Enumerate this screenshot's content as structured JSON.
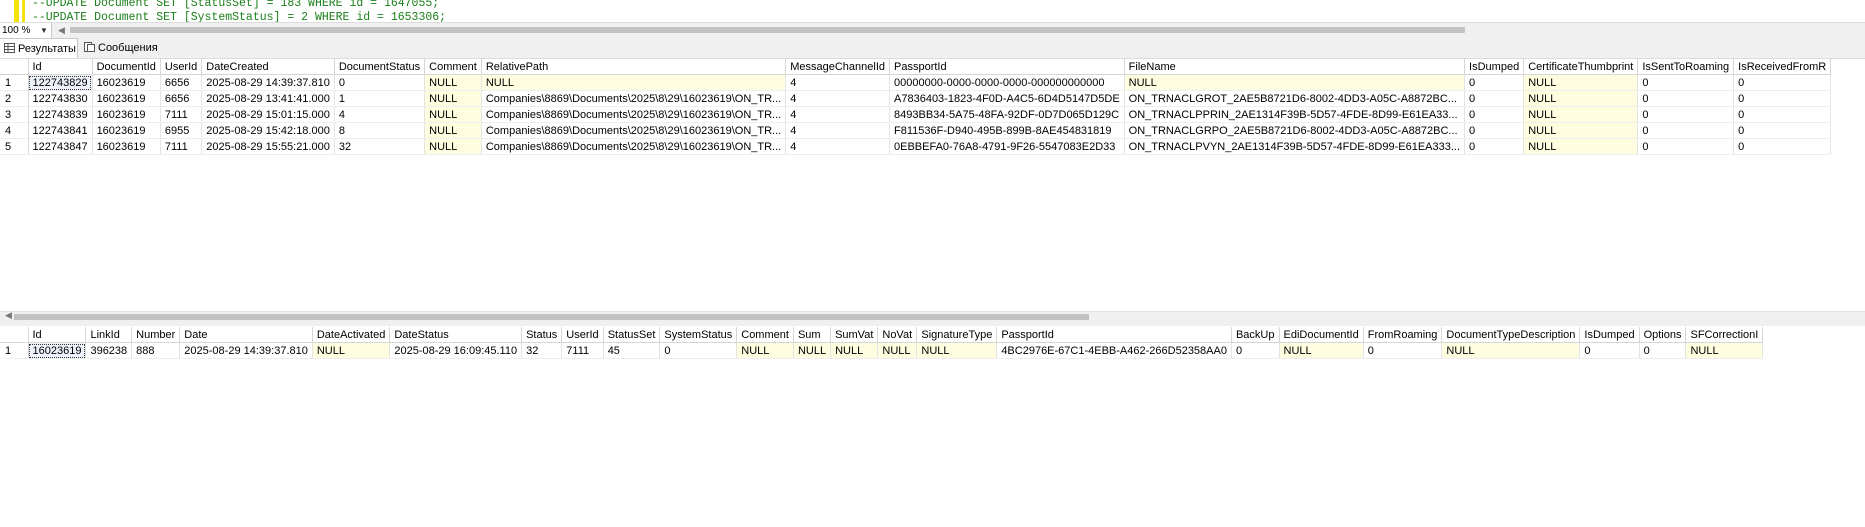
{
  "editor": {
    "line1": "--UPDATE Document SET [StatusSet] = 183 WHERE id = 1647055;",
    "line2": "--UPDATE Document SET [SystemStatus] = 2 WHERE id = 1653306;"
  },
  "zoom": {
    "value": "100 %"
  },
  "tabs": {
    "results": "Результаты",
    "messages": "Сообщения"
  },
  "grid1": {
    "columns": [
      "Id",
      "DocumentId",
      "UserId",
      "DateCreated",
      "DocumentStatus",
      "Comment",
      "RelativePath",
      "MessageChannelId",
      "PassportId",
      "FileName",
      "IsDumped",
      "CertificateThumbprint",
      "IsSentToRoaming",
      "IsReceivedFromR"
    ],
    "rows": [
      {
        "n": "1",
        "c": [
          "122743829",
          "16023619",
          "6656",
          "2025-08-29 14:39:37.810",
          "0",
          "NULL",
          "NULL",
          "4",
          "00000000-0000-0000-0000-000000000000",
          "NULL",
          "0",
          "NULL",
          "0",
          "0"
        ]
      },
      {
        "n": "2",
        "c": [
          "122743830",
          "16023619",
          "6656",
          "2025-08-29 13:41:41.000",
          "1",
          "NULL",
          "Companies\\8869\\Documents\\2025\\8\\29\\16023619\\ON_TR...",
          "4",
          "A7836403-1823-4F0D-A4C5-6D4D5147D5DE",
          "ON_TRNACLGROT_2AE5B8721D6-8002-4DD3-A05C-A8872BC...",
          "0",
          "NULL",
          "0",
          "0"
        ]
      },
      {
        "n": "3",
        "c": [
          "122743839",
          "16023619",
          "7111",
          "2025-08-29 15:01:15.000",
          "4",
          "NULL",
          "Companies\\8869\\Documents\\2025\\8\\29\\16023619\\ON_TR...",
          "4",
          "8493BB34-5A75-48FA-92DF-0D7D065D129C",
          "ON_TRNACLPPRIN_2AE1314F39B-5D57-4FDE-8D99-E61EA33...",
          "0",
          "NULL",
          "0",
          "0"
        ]
      },
      {
        "n": "4",
        "c": [
          "122743841",
          "16023619",
          "6955",
          "2025-08-29 15:42:18.000",
          "8",
          "NULL",
          "Companies\\8869\\Documents\\2025\\8\\29\\16023619\\ON_TR...",
          "4",
          "F811536F-D940-495B-899B-8AE454831819",
          "ON_TRNACLGRPO_2AE5B8721D6-8002-4DD3-A05C-A8872BC...",
          "0",
          "NULL",
          "0",
          "0"
        ]
      },
      {
        "n": "5",
        "c": [
          "122743847",
          "16023619",
          "7111",
          "2025-08-29 15:55:21.000",
          "32",
          "NULL",
          "Companies\\8869\\Documents\\2025\\8\\29\\16023619\\ON_TR...",
          "4",
          "0EBBEFA0-76A8-4791-9F26-5547083E2D33",
          "ON_TRNACLPVYN_2AE1314F39B-5D57-4FDE-8D99-E61EA333...",
          "0",
          "NULL",
          "0",
          "0"
        ]
      }
    ]
  },
  "grid2": {
    "columns": [
      "Id",
      "LinkId",
      "Number",
      "Date",
      "DateActivated",
      "DateStatus",
      "Status",
      "UserId",
      "StatusSet",
      "SystemStatus",
      "Comment",
      "Sum",
      "SumVat",
      "NoVat",
      "SignatureType",
      "PassportId",
      "BackUp",
      "EdiDocumentId",
      "FromRoaming",
      "DocumentTypeDescription",
      "IsDumped",
      "Options",
      "SFCorrectionI"
    ],
    "rows": [
      {
        "n": "1",
        "c": [
          "16023619",
          "396238",
          "888",
          "2025-08-29 14:39:37.810",
          "NULL",
          "2025-08-29 16:09:45.110",
          "32",
          "7111",
          "45",
          "0",
          "NULL",
          "NULL",
          "NULL",
          "NULL",
          "NULL",
          "4BC2976E-67C1-4EBB-A462-266D52358AA0",
          "0",
          "NULL",
          "0",
          "NULL",
          "0",
          "0",
          "NULL"
        ]
      }
    ]
  },
  "colors": {
    "null_bg": "#fffde0",
    "code_comment": "#1a7f1a",
    "scroll_thumb": "#c2c2c2"
  },
  "icons": {
    "results_tab": "grid-icon",
    "messages_tab": "message-icon"
  }
}
